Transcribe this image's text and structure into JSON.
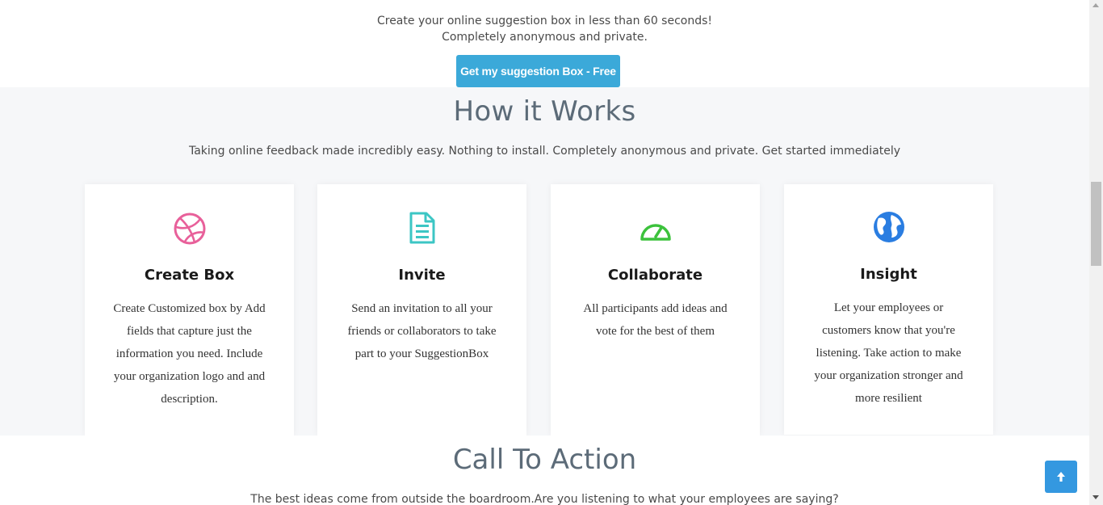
{
  "hero": {
    "line1": "Create your online suggestion box in less than 60 seconds!",
    "line2": "Completely anonymous and private.",
    "button_label": "Get my suggestion Box - Free"
  },
  "how_it_works": {
    "title": "How it Works",
    "subtitle": "Taking online feedback made incredibly easy. Nothing to install. Completely anonymous and private. Get started immediately",
    "cards": [
      {
        "icon": "dribbble-ball-icon",
        "icon_color": "#e8609a",
        "title": "Create Box",
        "text": "Create Customized box by Add fields that capture just the information you need. Include your organization logo and and description."
      },
      {
        "icon": "document-icon",
        "icon_color": "#3cc6c4",
        "title": "Invite",
        "text": "Send an invitation to all your friends or collaborators to take part to your SuggestionBox"
      },
      {
        "icon": "speedometer-icon",
        "icon_color": "#3cc23c",
        "title": "Collaborate",
        "text": "All participants add ideas and vote for the best of them"
      },
      {
        "icon": "globe-icon",
        "icon_color": "#2a7de1",
        "title": "Insight",
        "text": "Let your employees or customers know that you're listening. Take action to make your organization stronger and more resilient"
      }
    ]
  },
  "call_to_action": {
    "title": "Call To Action",
    "subtitle": "The best ideas come from outside the boardroom.Are you listening to what your employees are saying?"
  },
  "back_to_top": {
    "icon": "arrow-up-icon",
    "color": "#3498e0"
  }
}
